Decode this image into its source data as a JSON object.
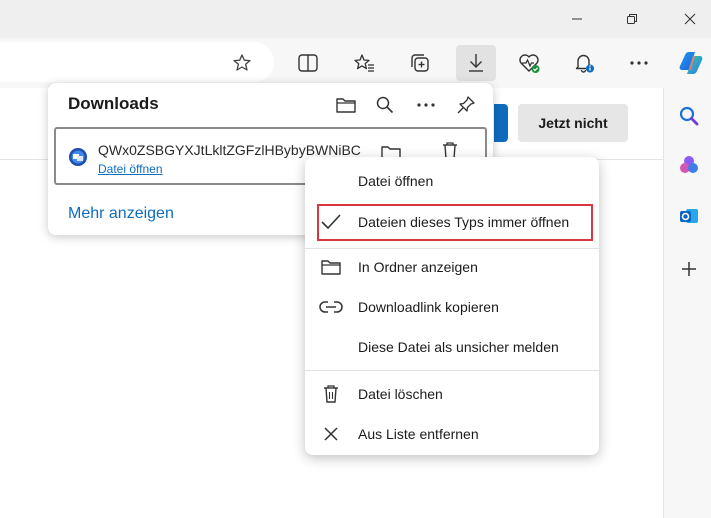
{
  "window": {
    "controls": [
      {
        "name": "minimize-icon"
      },
      {
        "name": "restore-icon"
      },
      {
        "name": "close-icon"
      }
    ]
  },
  "toolbar": {
    "buttons": [
      {
        "name": "split-screen-icon"
      },
      {
        "name": "favorites-icon"
      },
      {
        "name": "collections-icon"
      },
      {
        "name": "downloads-icon",
        "active": true
      },
      {
        "name": "browser-essentials-icon"
      },
      {
        "name": "notifications-icon"
      },
      {
        "name": "more-icon"
      },
      {
        "name": "copilot-icon"
      }
    ],
    "favorite_star": "star-icon"
  },
  "page": {
    "not_now_label": "Jetzt nicht"
  },
  "sidebar": {
    "icons": [
      "search-icon",
      "copilot-icon",
      "outlook-icon",
      "add-icon"
    ]
  },
  "downloads": {
    "title": "Downloads",
    "file_name": "QWx0ZSBGYXJtLkltZGFzlHBybyBWNiBC",
    "open_file_label": "Datei öffnen",
    "show_more_label": "Mehr anzeigen"
  },
  "context_menu": {
    "items": [
      {
        "label": "Datei öffnen",
        "icon": ""
      },
      {
        "label": "Dateien dieses Typs immer öffnen",
        "icon": "checkmark-icon",
        "highlighted": true
      },
      {
        "label": "In Ordner anzeigen",
        "icon": "folder-icon"
      },
      {
        "label": "Downloadlink kopieren",
        "icon": "link-icon"
      },
      {
        "label": "Diese Datei als unsicher melden",
        "icon": ""
      },
      {
        "label": "Datei löschen",
        "icon": "trash-icon"
      },
      {
        "label": "Aus Liste entfernen",
        "icon": "close-icon"
      }
    ]
  },
  "colors": {
    "accent": "#0f6cbd",
    "highlight_border": "#d9363e"
  }
}
